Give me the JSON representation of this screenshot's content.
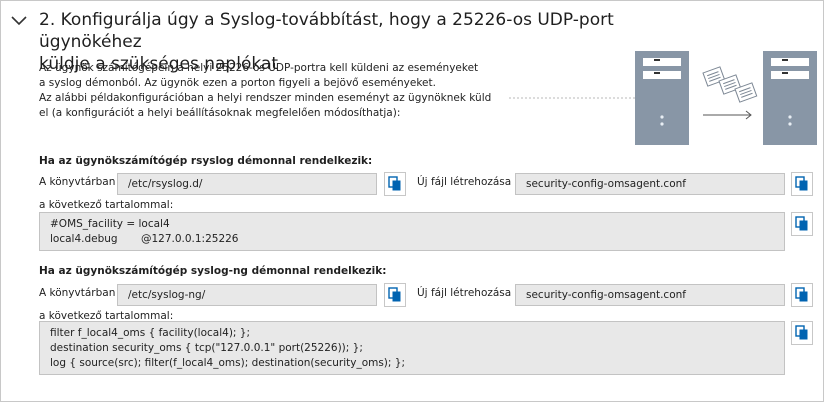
{
  "step": {
    "title_line1": "2. Konfigurálja úgy a Syslog-továbbítást, hogy a 25226-os UDP-port ügynökéhez",
    "title_line2": "küldje a szükséges naplókat"
  },
  "description": [
    "Az ügynök számítógépein a helyi 25226-os UDP-portra kell küldeni az eseményeket",
    "a syslog démonból. Az ügynök ezen a porton figyeli a bejövő eseményeket.",
    "Az alábbi példakonfigurációban a helyi rendszer minden eseményt az ügynöknek küld",
    "el (a konfigurációt a helyi beállításoknak megfelelően módosíthatja):"
  ],
  "rsyslog": {
    "heading": "Ha az ügynökszámítógép rsyslog démonnal rendelkezik:",
    "dir_label": "A könyvtárban",
    "dir_value": "/etc/rsyslog.d/",
    "file_label": "Új fájl létrehozása",
    "file_value": "security-config-omsagent.conf",
    "content_label": "a következő tartalommal:",
    "content_lines": [
      "#OMS_facility = local4",
      "local4.debug       @127.0.0.1:25226"
    ]
  },
  "syslog_ng": {
    "heading": "Ha az ügynökszámítógép syslog-ng démonnal rendelkezik:",
    "dir_label": "A könyvtárban",
    "dir_value": "/etc/syslog-ng/",
    "file_label": "Új fájl létrehozása",
    "file_value": "security-config-omsagent.conf",
    "content_label": "a következő tartalommal:",
    "content_lines": [
      "filter f_local4_oms { facility(local4); };",
      "destination security_oms { tcp(\"127.0.0.1\" port(25226)); };",
      "log { source(src); filter(f_local4_oms); destination(security_oms); };"
    ]
  },
  "icons": {
    "expand": "chevron-down-icon",
    "copy": "copy-icon",
    "servers": "server-tower-icon",
    "logs": "log-documents-icon"
  },
  "colors": {
    "copy_icon": "#0063b1",
    "server_body": "#8896a6",
    "field_bg": "#e8e8e8"
  }
}
